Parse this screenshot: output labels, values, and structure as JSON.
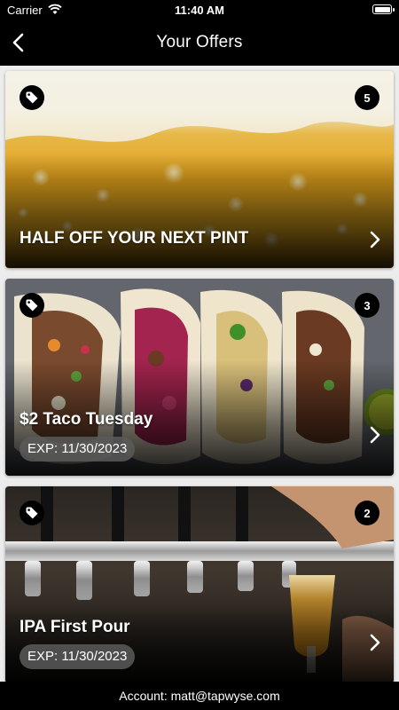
{
  "status_bar": {
    "carrier": "Carrier",
    "time": "11:40 AM"
  },
  "nav": {
    "title": "Your Offers",
    "back_icon": "chevron-left-icon"
  },
  "offers": [
    {
      "title": "HALF OFF YOUR NEXT PINT",
      "count": "5",
      "expiration": "",
      "image": "beer-foam-photo"
    },
    {
      "title": "$2 Taco Tuesday",
      "count": "3",
      "expiration": "EXP: 11/30/2023",
      "image": "tacos-photo"
    },
    {
      "title": "IPA First Pour",
      "count": "2",
      "expiration": "EXP: 11/30/2023",
      "image": "beer-taps-photo"
    }
  ],
  "footer": {
    "account": "Account: matt@tapwyse.com"
  },
  "colors": {
    "bars": "#000000",
    "background": "#ececec",
    "badge": "#000000",
    "exp_pill": "#5a5a5a"
  }
}
